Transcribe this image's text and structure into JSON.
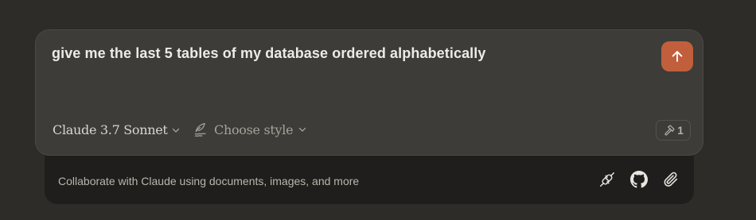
{
  "composer": {
    "prompt_text": "give me the last 5 tables of my database ordered alphabetically",
    "send_icon": "arrow-up-icon",
    "model_label": "Claude 3.7 Sonnet",
    "style_label": "Choose style",
    "style_icon": "handwriting-feather-icon",
    "tools_icon": "hammer-icon",
    "tools_count": "1",
    "send_color": "#c15f3c"
  },
  "tray": {
    "text": "Collaborate with Claude using documents, images, and more",
    "icons": [
      "plug-icon",
      "github-icon",
      "paperclip-icon"
    ]
  }
}
